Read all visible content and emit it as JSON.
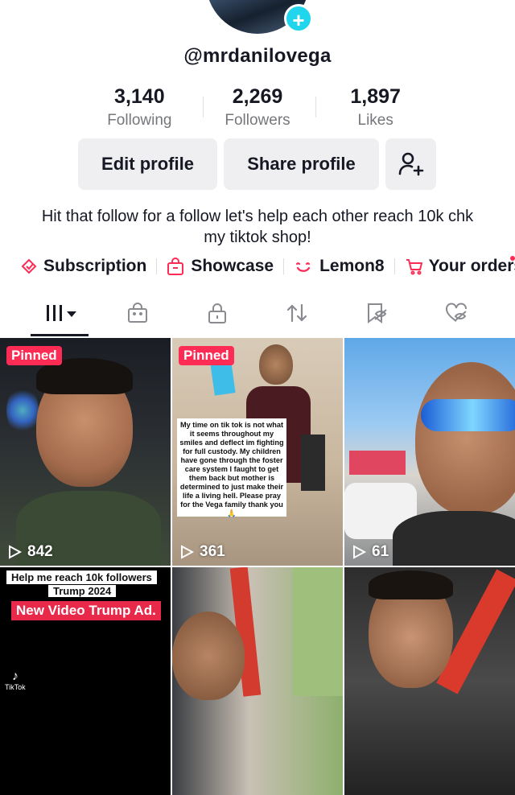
{
  "profile": {
    "username": "@mrdanilovega",
    "stats": [
      {
        "value": "3,140",
        "label": "Following"
      },
      {
        "value": "2,269",
        "label": "Followers"
      },
      {
        "value": "1,897",
        "label": "Likes"
      }
    ],
    "buttons": {
      "edit": "Edit profile",
      "share": "Share profile"
    },
    "bio": "Hit that follow for a follow let's help each other reach 10k chk my tiktok shop!",
    "links": [
      "Subscription",
      "Showcase",
      "Lemon8",
      "Your orders"
    ]
  },
  "tabs": [
    "videos",
    "shop",
    "private",
    "reposts",
    "favorites",
    "liked"
  ],
  "videos": [
    {
      "pinned": "Pinned",
      "views": "842"
    },
    {
      "pinned": "Pinned",
      "views": "361",
      "caption": "My time on tik tok is not what it seems throughout my smiles and deflect im fighting for full custody. My children have gone through the foster care system I faught to get them back but mother is determined to just make their life a living hell. Please pray for the Vega family thank you 🙏"
    },
    {
      "views": "61"
    },
    {
      "caption_top": "Help me reach 10k followers",
      "caption_mid": "Trump 2024",
      "caption_red": "New Video Trump Ad.",
      "watermark": "TikTok"
    },
    {},
    {}
  ],
  "colors": {
    "accent": "#fe2c55",
    "avatar_add": "#20d5ec"
  }
}
